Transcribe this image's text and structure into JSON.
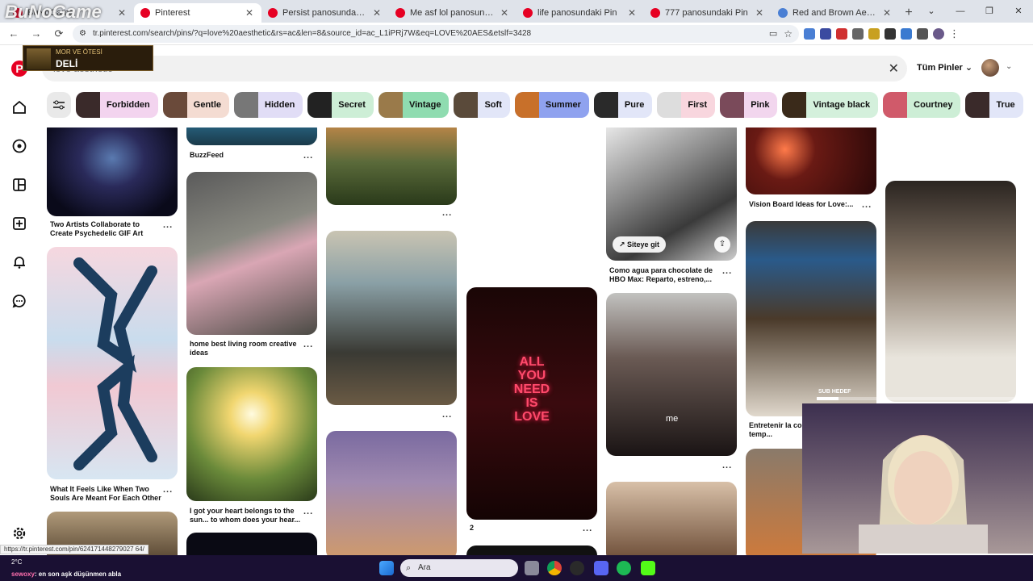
{
  "browser": {
    "tabs": [
      {
        "label": "BuNoGame",
        "icon": "pinterest-icon",
        "active": false
      },
      {
        "label": "Pinterest",
        "icon": "pinterest-icon",
        "active": true
      },
      {
        "label": "Persist panosundaki Pin",
        "icon": "pinterest-icon",
        "active": false
      },
      {
        "label": "Me asf lol panosundaki Pin",
        "icon": "pinterest-icon",
        "active": false
      },
      {
        "label": "life panosundaki Pin",
        "icon": "pinterest-icon",
        "active": false
      },
      {
        "label": "777 panosundaki Pin",
        "icon": "pinterest-icon",
        "active": false
      },
      {
        "label": "Red and Brown Aesthetic Vision",
        "icon": "globe-icon",
        "active": false
      }
    ],
    "new_tab": "+",
    "window_controls": [
      "⌄",
      "—",
      "❐",
      "✕"
    ],
    "back": "←",
    "forward": "→",
    "reload": "⟳",
    "url": "tr.pinterest.com/search/pins/?q=love%20aesthetic&rs=ac&len=8&source_id=ac_L1iPRj7W&eq=LOVE%20AES&etslf=3428"
  },
  "header": {
    "logo": "P",
    "search_value": "love aesthetic",
    "clear": "✕",
    "scope_label": "Tüm Pinler",
    "scope_chevron": "⌄"
  },
  "chips": [
    {
      "label": "Forbidden",
      "bg": "#f3d4ef",
      "thumb": "#3a2a2a"
    },
    {
      "label": "Gentle",
      "bg": "#f4dcd2",
      "thumb": "#6a4a3a"
    },
    {
      "label": "Hidden",
      "bg": "#e1ddf6",
      "thumb": "#777777"
    },
    {
      "label": "Secret",
      "bg": "#cdeed6",
      "thumb": "#222222"
    },
    {
      "label": "Vintage",
      "bg": "#8fdcb0",
      "thumb": "#9a7a4a"
    },
    {
      "label": "Soft",
      "bg": "#e2e6f8",
      "thumb": "#5a4a3a"
    },
    {
      "label": "Summer",
      "bg": "#8fa2ef",
      "thumb": "#c8702a"
    },
    {
      "label": "Pure",
      "bg": "#e2e6f8",
      "thumb": "#2a2a2a"
    },
    {
      "label": "First",
      "bg": "#f8d6de",
      "thumb": "#dddddd"
    },
    {
      "label": "Pink",
      "bg": "#f2d6ee",
      "thumb": "#7a4a5a"
    },
    {
      "label": "Vintage black",
      "bg": "#d4f0dc",
      "thumb": "#3a2a1a"
    },
    {
      "label": "Courtney",
      "bg": "#cdeed6",
      "thumb": "#d05a6a"
    },
    {
      "label": "True",
      "bg": "#e2e6f8",
      "thumb": "#3a2a2a"
    }
  ],
  "pins": {
    "col1": [
      {
        "caption": "Two Artists Collaborate to Create Psychedelic GIF Art"
      },
      {
        "caption": "What It Feels Like When Two Souls Are Meant For Each Other"
      }
    ],
    "col2": [
      {
        "caption": "BuzzFeed"
      },
      {
        "caption": "home best living room creative ideas"
      },
      {
        "caption": "I got your heart belongs to the sun... to whom does your hear..."
      }
    ],
    "col4": {
      "neon_text": [
        "ALL",
        "YOU",
        "NEED",
        "IS",
        "LOVE"
      ],
      "caption": "2"
    },
    "col5": {
      "visit_label": "Siteye git",
      "share_icon": "⇪",
      "caption": "Como agua para chocolate de HBO Max: Reparto, estreno,...",
      "me_label": "me"
    },
    "col6": [
      {
        "caption": "Vision Board Ideas for Love:..."
      },
      {
        "caption": "Entretenir la co... couple le temp..."
      }
    ],
    "more": "..."
  },
  "overlay": {
    "brand": "BuNoGame",
    "alert_line1": "MOR VE ÖTESİ",
    "alert_line2": "DELİ",
    "sub_goal_label": "SUB HEDEF",
    "sub_goal_progress": 0.1,
    "status_url": "https://tr.pinterest.com/pin/624171448279027 64/"
  },
  "taskbar": {
    "temperature": "2°C",
    "chat_user": "sewoxy",
    "chat_text": "en son aşk düşünmen abla",
    "search_label": "Ara",
    "search_icon": "⌕"
  }
}
